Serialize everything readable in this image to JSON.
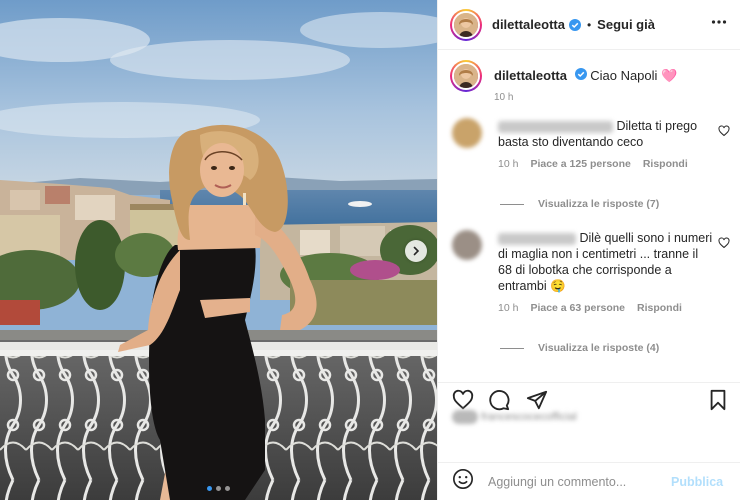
{
  "post": {
    "username": "dilettaleotta",
    "follow_label": "Segui già",
    "bullet": "•",
    "caption": "Ciao Napoli 🩷",
    "caption_time": "10 h"
  },
  "comments": [
    {
      "text": "Diletta ti prego basta sto diventando ceco",
      "time": "10 h",
      "likes": "Piace a 125 persone",
      "reply_label": "Rispondi",
      "view_replies": "Visualizza le risposte (7)",
      "avatar_color": "#c9a36a"
    },
    {
      "text": "Dilè quelli sono i numeri di maglia non i centimetri ... tranne il 68 di lobotka che corrisponde a entrambi 🤤",
      "time": "10 h",
      "likes": "Piace a 63 persone",
      "reply_label": "Rispondi",
      "view_replies": "Visualizza le risposte (4)",
      "avatar_color": "#9b8f86"
    }
  ],
  "likers_blurred": "francescocecofficial",
  "add_comment": {
    "placeholder": "Aggiungi un commento...",
    "publish_label": "Pubblica"
  },
  "colors": {
    "verified": "#3897f0",
    "muted": "#8e8e8e",
    "publish_disabled": "#b2dffc",
    "sky": "#8fb3d6",
    "sea": "#3f6f9c"
  },
  "icons": [
    "verified-badge-icon",
    "more-icon",
    "heart-icon",
    "comment-icon",
    "share-icon",
    "bookmark-icon",
    "emoji-icon",
    "chevron-right-icon"
  ],
  "carousel": {
    "slides": 3,
    "active": 1
  }
}
